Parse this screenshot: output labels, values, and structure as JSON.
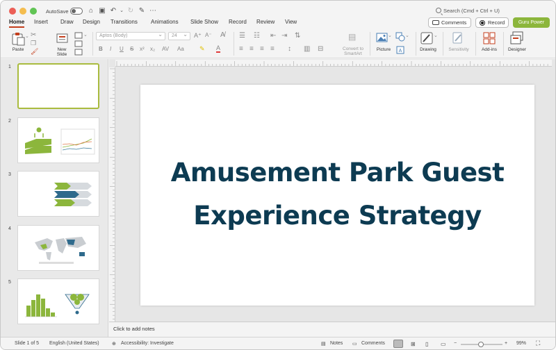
{
  "titlebar": {
    "autosave_label": "AutoSave",
    "search_placeholder": "Search (Cmd + Ctrl + U)"
  },
  "tabs": [
    {
      "label": "Home",
      "active": true
    },
    {
      "label": "Insert"
    },
    {
      "label": "Draw"
    },
    {
      "label": "Design"
    },
    {
      "label": "Transitions"
    },
    {
      "label": "Animations"
    },
    {
      "label": "Slide Show"
    },
    {
      "label": "Record"
    },
    {
      "label": "Review"
    },
    {
      "label": "View"
    }
  ],
  "actions": {
    "comments_label": "Comments",
    "record_label": "Record",
    "guru_label": "Guru Power"
  },
  "ribbon": {
    "paste_label": "Paste",
    "new_slide_label": "New\nSlide",
    "font_name": "Aptos (Body)",
    "font_size": "24",
    "convert_label": "Convert to\nSmartArt",
    "picture_label": "Picture",
    "drawing_label": "Drawing",
    "sensitivity_label": "Sensitivity",
    "addins_label": "Add-ins",
    "designer_label": "Designer",
    "accent_color": "#c43e1c"
  },
  "thumbnails": [
    {
      "number": "1",
      "selected": true
    },
    {
      "number": "2"
    },
    {
      "number": "3"
    },
    {
      "number": "4"
    },
    {
      "number": "5"
    }
  ],
  "slide": {
    "title_line1": "Amusement Park Guest",
    "title_line2": "Experience Strategy",
    "title_color": "#0d3b52"
  },
  "notes": {
    "placeholder": "Click to add notes"
  },
  "status": {
    "slide_position": "Slide 1 of 5",
    "language": "English (United States)",
    "accessibility": "Accessibility: Investigate",
    "notes_label": "Notes",
    "comments_label": "Comments",
    "zoom": "99%"
  }
}
